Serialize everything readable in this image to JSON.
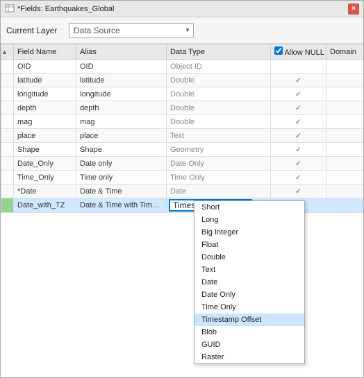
{
  "window": {
    "title": "*Fields: Earthquakes_Global",
    "close_label": "×"
  },
  "current_layer": {
    "label": "Current Layer",
    "dropdown_value": "Data Source",
    "dropdown_placeholder": "Data Source"
  },
  "table": {
    "columns": [
      {
        "id": "sort",
        "label": ""
      },
      {
        "id": "field_name",
        "label": "Field Name"
      },
      {
        "id": "alias",
        "label": "Alias"
      },
      {
        "id": "data_type",
        "label": "Data Type"
      },
      {
        "id": "allow_null",
        "label": "Allow NULL"
      },
      {
        "id": "domain",
        "label": "Domain"
      }
    ],
    "rows": [
      {
        "field_name": "OID",
        "alias": "OID",
        "data_type": "Object ID",
        "allow_null": false,
        "domain": "",
        "highlight": false
      },
      {
        "field_name": "latitude",
        "alias": "latitude",
        "data_type": "Double",
        "allow_null": true,
        "domain": "",
        "highlight": false
      },
      {
        "field_name": "longitude",
        "alias": "longitude",
        "data_type": "Double",
        "allow_null": true,
        "domain": "",
        "highlight": false
      },
      {
        "field_name": "depth",
        "alias": "depth",
        "data_type": "Double",
        "allow_null": true,
        "domain": "",
        "highlight": false
      },
      {
        "field_name": "mag",
        "alias": "mag",
        "data_type": "Double",
        "allow_null": true,
        "domain": "",
        "highlight": false
      },
      {
        "field_name": "place",
        "alias": "place",
        "data_type": "Text",
        "allow_null": true,
        "domain": "",
        "highlight": false
      },
      {
        "field_name": "Shape",
        "alias": "Shape",
        "data_type": "Geometry",
        "allow_null": true,
        "domain": "",
        "highlight": false
      },
      {
        "field_name": "Date_Only",
        "alias": "Date only",
        "data_type": "Date Only",
        "allow_null": true,
        "domain": "",
        "highlight": false
      },
      {
        "field_name": "Time_Only",
        "alias": "Time only",
        "data_type": "Time Only",
        "allow_null": true,
        "domain": "",
        "highlight": false
      },
      {
        "field_name": "*Date",
        "alias": "Date & Time",
        "data_type": "Date",
        "allow_null": true,
        "domain": "",
        "highlight": false
      },
      {
        "field_name": "Date_with_TZ",
        "alias": "Date & Time with Timezone Offset",
        "data_type": "Timestamp Offset",
        "allow_null": true,
        "domain": "",
        "highlight": true,
        "inline_dropdown": true
      }
    ]
  },
  "inline_dropdown": {
    "value": "Timestamp Offset",
    "options": [
      {
        "label": "Short",
        "selected": false
      },
      {
        "label": "Long",
        "selected": false
      },
      {
        "label": "Big Integer",
        "selected": false
      },
      {
        "label": "Float",
        "selected": false
      },
      {
        "label": "Double",
        "selected": false
      },
      {
        "label": "Text",
        "selected": false
      },
      {
        "label": "Date",
        "selected": false
      },
      {
        "label": "Date Only",
        "selected": false
      },
      {
        "label": "Time Only",
        "selected": false
      },
      {
        "label": "Timestamp Offset",
        "selected": true
      },
      {
        "label": "Blob",
        "selected": false
      },
      {
        "label": "GUID",
        "selected": false
      },
      {
        "label": "Raster",
        "selected": false
      }
    ]
  },
  "checkmark": "✓"
}
